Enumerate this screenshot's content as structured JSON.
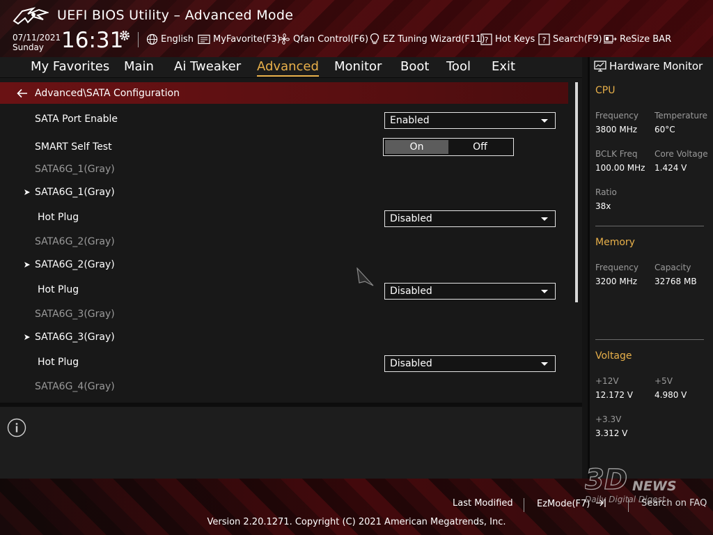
{
  "header": {
    "title": "UEFI BIOS Utility – Advanced Mode",
    "date": "07/11/2021",
    "day": "Sunday",
    "time": "16:31",
    "tools": [
      {
        "label": "English",
        "icon": "globe-icon"
      },
      {
        "label": "MyFavorite(F3)",
        "icon": "favorite-list-icon"
      },
      {
        "label": "Qfan Control(F6)",
        "icon": "fan-icon"
      },
      {
        "label": "EZ Tuning Wizard(F11)",
        "icon": "lightbulb-icon"
      },
      {
        "label": "Hot Keys",
        "icon": "question-icon"
      },
      {
        "label": "Search(F9)",
        "icon": "question-icon"
      },
      {
        "label": "ReSize BAR",
        "icon": "resize-bar-icon"
      }
    ]
  },
  "tabs": [
    {
      "label": "My Favorites"
    },
    {
      "label": "Main"
    },
    {
      "label": "Ai Tweaker"
    },
    {
      "label": "Advanced",
      "active": true
    },
    {
      "label": "Monitor"
    },
    {
      "label": "Boot"
    },
    {
      "label": "Tool"
    },
    {
      "label": "Exit"
    }
  ],
  "breadcrumb": "Advanced\\SATA Configuration",
  "settings": {
    "sata_port_enable": {
      "label": "SATA Port Enable",
      "value": "Enabled"
    },
    "smart_self_test": {
      "label": "SMART Self Test",
      "on": "On",
      "off": "Off",
      "selected": "On"
    },
    "port1_info": "SATA6G_1(Gray)",
    "port1_sub": "SATA6G_1(Gray)",
    "port1_hotplug": {
      "label": "Hot Plug",
      "value": "Disabled"
    },
    "port2_info": "SATA6G_2(Gray)",
    "port2_sub": "SATA6G_2(Gray)",
    "port2_hotplug": {
      "label": "Hot Plug",
      "value": "Disabled"
    },
    "port3_info": "SATA6G_3(Gray)",
    "port3_sub": "SATA6G_3(Gray)",
    "port3_hotplug": {
      "label": "Hot Plug",
      "value": "Disabled"
    },
    "port4_info": "SATA6G_4(Gray)"
  },
  "hardware_monitor": {
    "title": "Hardware Monitor",
    "cpu": {
      "section": "CPU",
      "frequency_label": "Frequency",
      "frequency": "3800 MHz",
      "temperature_label": "Temperature",
      "temperature": "60°C",
      "bclk_label": "BCLK Freq",
      "bclk": "100.00 MHz",
      "core_voltage_label": "Core Voltage",
      "core_voltage": "1.424 V",
      "ratio_label": "Ratio",
      "ratio": "38x"
    },
    "memory": {
      "section": "Memory",
      "frequency_label": "Frequency",
      "frequency": "3200 MHz",
      "capacity_label": "Capacity",
      "capacity": "32768 MB"
    },
    "voltage": {
      "section": "Voltage",
      "v12_label": "+12V",
      "v12": "12.172 V",
      "v5_label": "+5V",
      "v5": "4.980 V",
      "v33_label": "+3.3V",
      "v33": "3.312 V"
    }
  },
  "footer": {
    "last_modified": "Last Modified",
    "ezmode": "EzMode(F7)",
    "search_faq": "Search on FAQ",
    "copyright": "Version 2.20.1271. Copyright (C) 2021 American Megatrends, Inc."
  },
  "watermark": {
    "brand": "3DNEWS",
    "tagline": "Daily Digital Digest"
  },
  "colors": {
    "accent": "#e8b04a",
    "breadcrumb_bg": "#6a1214",
    "header_red": "#4e0e11"
  }
}
